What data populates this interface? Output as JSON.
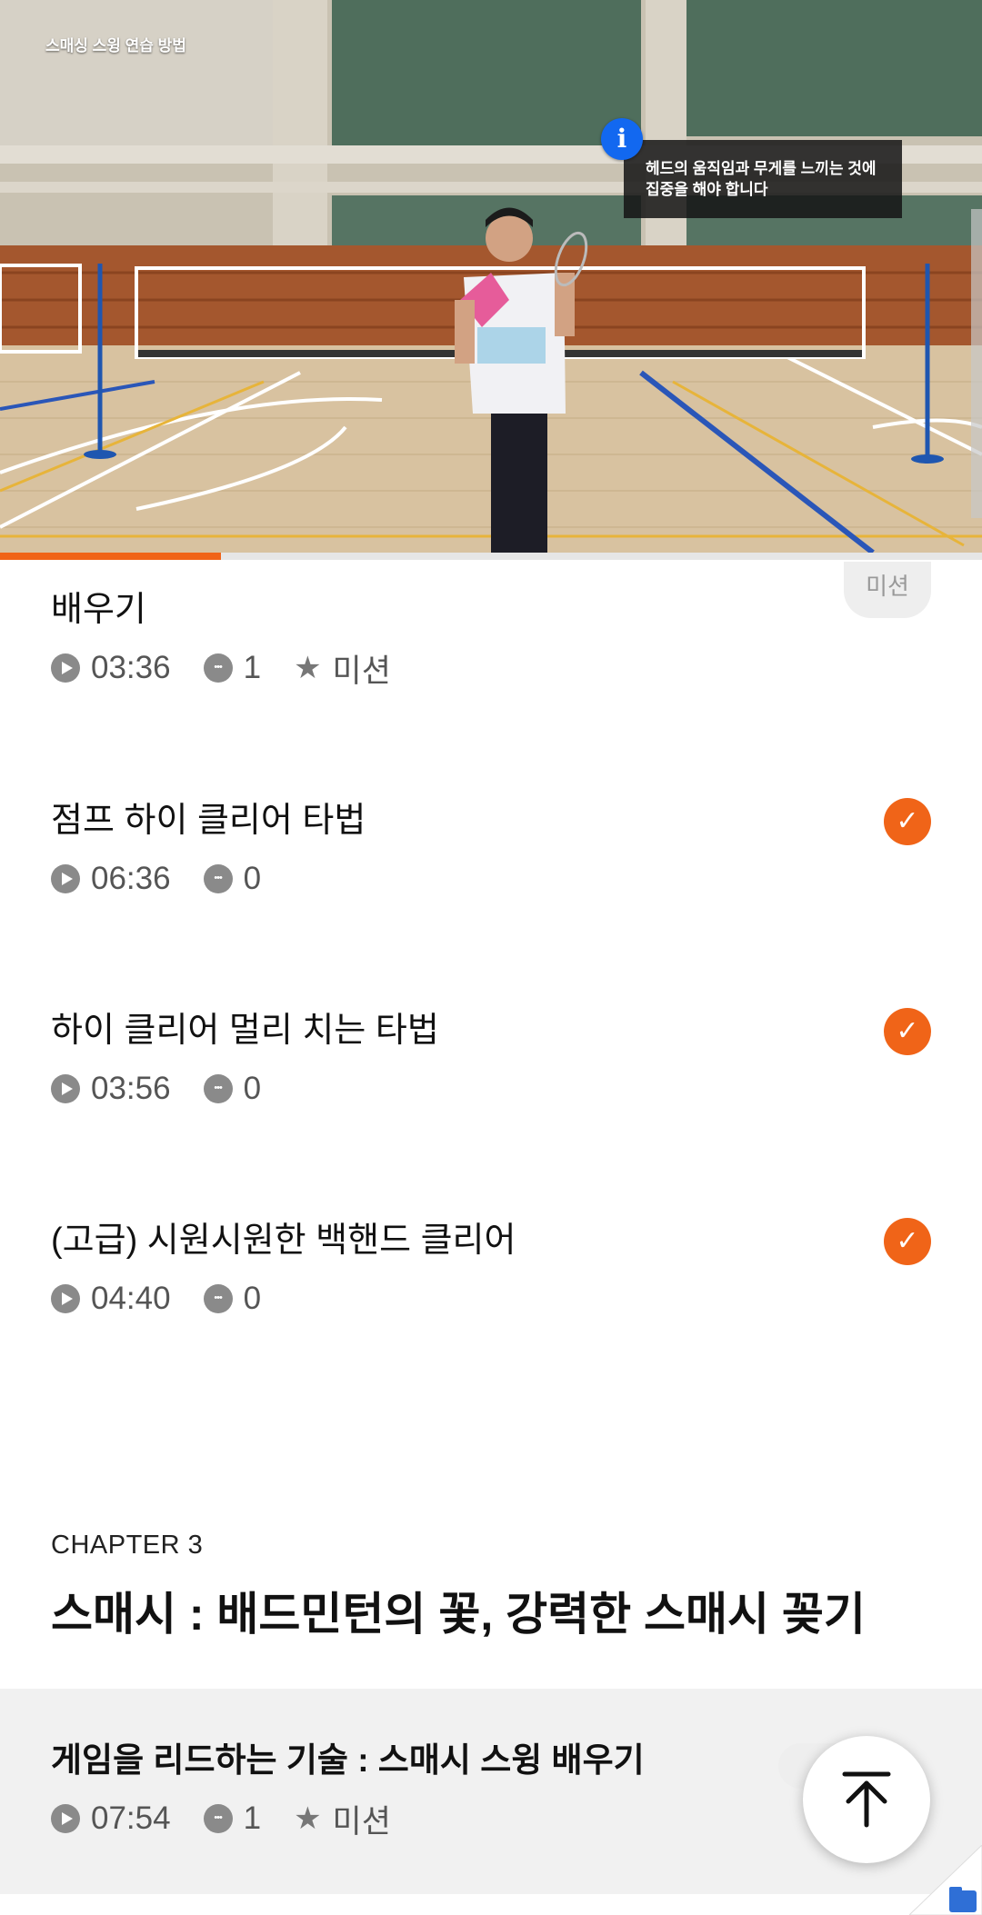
{
  "video": {
    "title": "스매싱 스윙 연습 방법",
    "overlay_note_line1": "헤드의 움직임과 무게를 느끼는 것에",
    "overlay_note_line2": "집중을 해야 합니다",
    "info_icon": "i",
    "progress_fraction": 0.225
  },
  "lessons": [
    {
      "title": "배우기",
      "duration": "03:36",
      "comments": "1",
      "mission_label": "미션",
      "badge": "미션"
    },
    {
      "title": "점프 하이 클리어 타법",
      "duration": "06:36",
      "comments": "0",
      "completed": true
    },
    {
      "title": "하이 클리어 멀리 치는 타법",
      "duration": "03:56",
      "comments": "0",
      "completed": true
    },
    {
      "title": "(고급) 시원시원한 백핸드 클리어",
      "duration": "04:40",
      "comments": "0",
      "completed": true
    }
  ],
  "chapter": {
    "label": "CHAPTER 3",
    "title": "스매시 : 배드민턴의 꽃, 강력한 스매시 꽂기"
  },
  "current_lesson": {
    "title": "게임을 리드하는 기술 : 스매시 스윙 배우기",
    "duration": "07:54",
    "comments": "1",
    "mission_label": "미션",
    "badge": "미"
  },
  "colors": {
    "accent": "#f06418",
    "info_blue": "#1268f0"
  },
  "icons": {
    "play": "play-icon",
    "comment": "comment-icon",
    "star": "star-icon",
    "check": "check-icon",
    "scroll_top": "arrow-up-icon",
    "info": "info-icon"
  }
}
